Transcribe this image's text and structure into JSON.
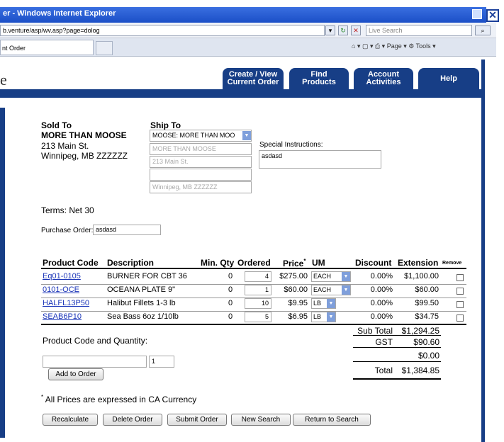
{
  "browser": {
    "title": "er - Windows Internet Explorer",
    "close_glyph": "✕",
    "address": "b.venture/asp/wv.asp?page=dolog",
    "search_placeholder": "Live Search",
    "tab_title": "nt Order",
    "toolbar_right": "⌂ ▾ ▢ ▾ ⎙ ▾ Page ▾ ⚙ Tools ▾"
  },
  "site": {
    "logo_fragment": "e",
    "nav": [
      {
        "label": "Create / View\nCurrent Order"
      },
      {
        "label": "Find\nProducts"
      },
      {
        "label": "Account\nActivities"
      },
      {
        "label": "Help"
      }
    ]
  },
  "sold_to": {
    "heading": "Sold To",
    "name": "MORE THAN MOOSE",
    "address1": "213 Main St.",
    "city_line": "Winnipeg, MB  ZZZZZZ"
  },
  "ship_to": {
    "heading": "Ship To",
    "select_value": "MOOSE: MORE THAN MOO",
    "name": "MORE THAN MOOSE",
    "address1": "213 Main St.",
    "address2": "",
    "city_line": "Winnipeg, MB  ZZZZZZ"
  },
  "special_instructions": {
    "label": "Special Instructions:",
    "value": "asdasd"
  },
  "terms": "Terms: Net 30",
  "purchase_order": {
    "label": "Purchase Order:",
    "value": "asdasd"
  },
  "table": {
    "headers": {
      "code": "Product Code",
      "description": "Description",
      "min_qty": "Min. Qty",
      "ordered": "Ordered",
      "price": "Price",
      "price_mark": "*",
      "um": "UM",
      "discount": "Discount",
      "extension": "Extension",
      "remove": "Remove"
    },
    "rows": [
      {
        "code": "Eq01-0105",
        "description": "BURNER FOR CBT 36",
        "min_qty": "0",
        "ordered": "4",
        "price": "$275.00",
        "um": "EACH",
        "discount": "0.00%",
        "extension": "$1,100.00"
      },
      {
        "code": "0101-OCE",
        "description": "OCEANA PLATE 9\"",
        "min_qty": "0",
        "ordered": "1",
        "price": "$60.00",
        "um": "EACH",
        "discount": "0.00%",
        "extension": "$60.00"
      },
      {
        "code": "HALFL13P50",
        "description": "Halibut Fillets 1-3 lb",
        "min_qty": "0",
        "ordered": "10",
        "price": "$9.95",
        "um": "LB",
        "discount": "0.00%",
        "extension": "$99.50"
      },
      {
        "code": "SEAB6P10",
        "description": "Sea Bass 6oz 1/10lb",
        "min_qty": "0",
        "ordered": "5",
        "price": "$6.95",
        "um": "LB",
        "discount": "0.00%",
        "extension": "$34.75"
      }
    ]
  },
  "totals": {
    "subtotal_label": "Sub Total",
    "subtotal": "$1,294.25",
    "gst_label": "GST",
    "gst": "$90.60",
    "other": "$0.00",
    "total_label": "Total",
    "total": "$1,384.85"
  },
  "add_product": {
    "label": "Product Code and Quantity:",
    "code_value": "",
    "qty_value": "1",
    "button": "Add to Order"
  },
  "currency_note_mark": "*",
  "currency_note": " All Prices are expressed in CA Currency",
  "actions": [
    "Recalculate",
    "Delete Order",
    "Submit Order",
    "New Search",
    "Return to Search"
  ]
}
